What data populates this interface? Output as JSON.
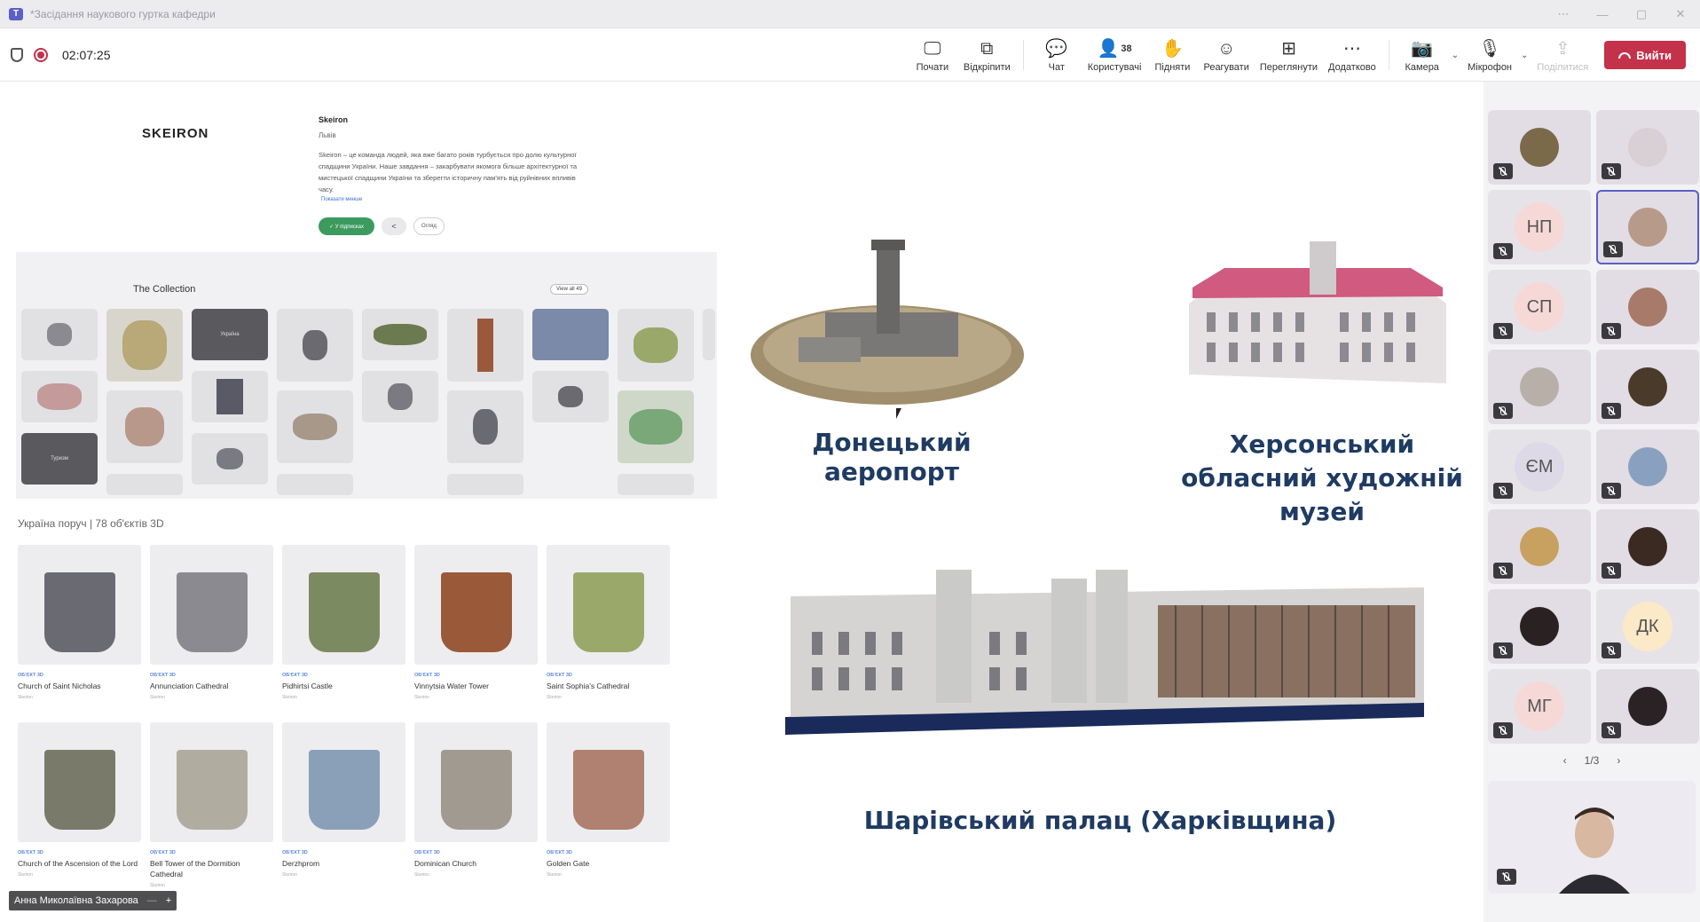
{
  "window": {
    "title": "*Засідання наукового гуртка кафедри"
  },
  "toolbar": {
    "timer": "02:07:25",
    "buttons": {
      "start": "Почати",
      "popout": "Відкріпити",
      "chat": "Чат",
      "people": "Користувачі",
      "people_count": "38",
      "raise": "Підняти",
      "react": "Реагувати",
      "view": "Переглянути",
      "more": "Додатково",
      "camera": "Камера",
      "mic": "Мікрофон",
      "share": "Поділитися"
    },
    "leave": "Вийти"
  },
  "shared_screen": {
    "site": {
      "logo": "SKEIRON",
      "name": "Skeiron",
      "city": "Львів",
      "description": "Skeiron – це команда людей, яка вже багато років турбується про долю культурної спадщини України. Наше завдання – закарбувати якомога більше архітектурної та мистецької спадщини України та зберегти історичну пам'ять від руйнівних впливів часу.",
      "show_more": "Показати менше",
      "subscribed": "✓ У підписках",
      "share_icon": "share-icon",
      "likes": "Огляд"
    },
    "collection": {
      "title": "The Collection",
      "view_all": "View all 49",
      "tiles": [
        "Україна",
        "Туризм"
      ]
    },
    "ukraine_section": {
      "title": "Україна поруч | 78 об'єктів 3D",
      "tag": "ОБ'ЄКТ 3D",
      "author": "Skeiron",
      "cards": [
        {
          "name": "Church of Saint Nicholas",
          "color": "#6a6a72"
        },
        {
          "name": "Annunciation Cathedral",
          "color": "#8a8a90"
        },
        {
          "name": "Pidhirtsi Castle",
          "color": "#7c8a62"
        },
        {
          "name": "Vinnytsia Water Tower",
          "color": "#9a5a3a"
        },
        {
          "name": "Saint Sophia's Cathedral",
          "color": "#9aa86a"
        },
        {
          "name": "Church of the Ascension of the Lord",
          "color": "#7a7a6a"
        },
        {
          "name": "Bell Tower of the Dormition Cathedral",
          "color": "#b0aca0"
        },
        {
          "name": "Derzhprom",
          "color": "#8aa0b8"
        },
        {
          "name": "Dominican Church",
          "color": "#a09a90"
        },
        {
          "name": "Golden Gate",
          "color": "#b08070"
        }
      ]
    },
    "slide": {
      "label_airport": "Донецький аеропорт",
      "label_museum": "Херсонський обласний художній музей",
      "label_palace": "Шарівський палац (Харківщина)"
    },
    "presenter": "Анна Миколаївна Захарова"
  },
  "participants": {
    "tiles": [
      {
        "type": "video",
        "color": "#7a6a4a"
      },
      {
        "type": "video",
        "color": "#d8d0d4"
      },
      {
        "type": "initials",
        "text": "НП",
        "bg": "#f6d9d6"
      },
      {
        "type": "video",
        "color": "#b89a8a",
        "selected": true
      },
      {
        "type": "initials",
        "text": "СП",
        "bg": "#f6d9d6"
      },
      {
        "type": "video",
        "color": "#a87a6a"
      },
      {
        "type": "video",
        "color": "#b8b0a8"
      },
      {
        "type": "video",
        "color": "#4a3a2a"
      },
      {
        "type": "initials",
        "text": "ЄМ",
        "bg": "#ddd9e6"
      },
      {
        "type": "video",
        "color": "#8aa0c0"
      },
      {
        "type": "video",
        "color": "#c8a060"
      },
      {
        "type": "video",
        "color": "#3a2a22"
      },
      {
        "type": "video",
        "color": "#2a2222"
      },
      {
        "type": "initials",
        "text": "ДК",
        "bg": "#fbe9c8"
      },
      {
        "type": "initials",
        "text": "МГ",
        "bg": "#f6d9d6"
      },
      {
        "type": "video",
        "color": "#2a2224"
      }
    ],
    "pager": "1/3"
  }
}
